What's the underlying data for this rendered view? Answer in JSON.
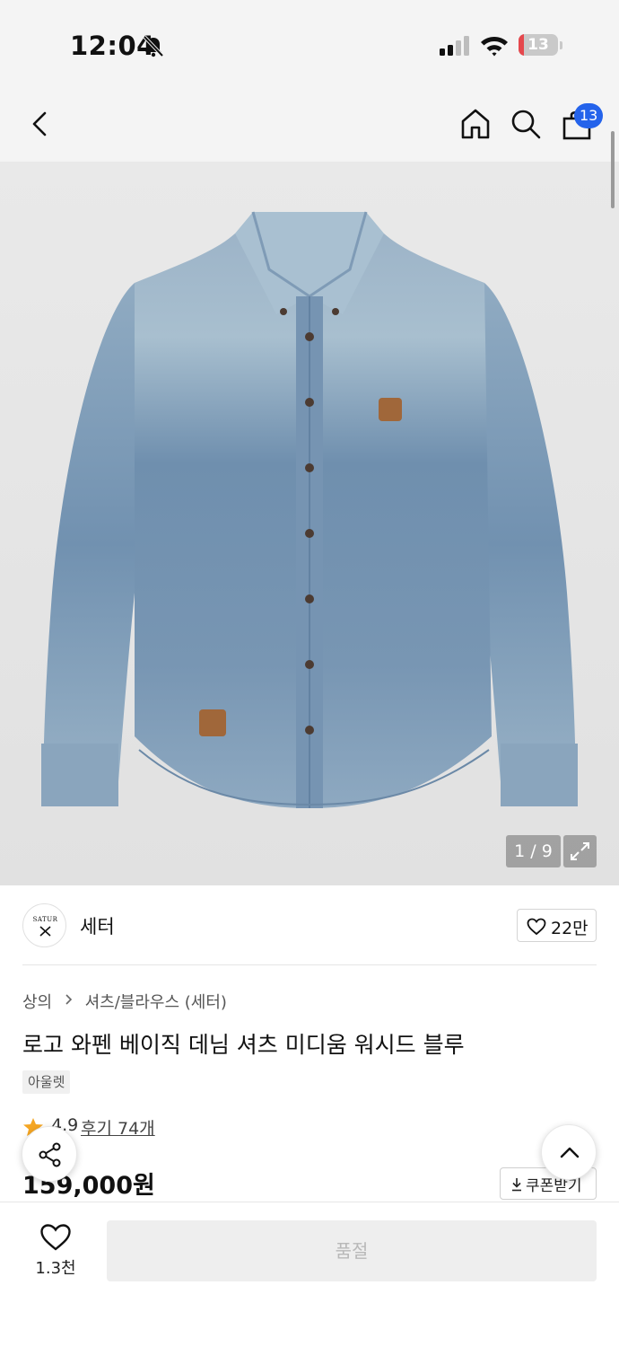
{
  "status_bar": {
    "time": "12:04",
    "battery_level": "13",
    "battery_percent": 13,
    "icons": [
      "bell-slash-icon",
      "cellular-signal-icon",
      "wifi-icon",
      "battery-charging-icon"
    ]
  },
  "nav": {
    "back_icon": "chevron-left-icon",
    "home_icon": "home-icon",
    "search_icon": "search-icon",
    "cart_icon": "shopping-bag-icon",
    "cart_count": "13",
    "badge_color": "#2463eb"
  },
  "gallery": {
    "counter": "1 / 9",
    "expand_icon": "expand-arrows-icon",
    "image_subject": "denim-shirt"
  },
  "brand": {
    "name": "세터",
    "logo_text": "SATUR",
    "like_count": "22만"
  },
  "product": {
    "breadcrumb": [
      "상의",
      "셔츠/블라우스 (세터)"
    ],
    "title": "로고 와펜 베이직 데님 셔츠 미디움 워시드 블루",
    "tag": "아울렛",
    "rating": "4.9",
    "review_link": "후기 74개",
    "price": "159,000원",
    "coupon_label": "쿠폰받기",
    "star_color": "#f5a623"
  },
  "floating": {
    "share_icon": "share-icon",
    "top_icon": "chevron-up-icon"
  },
  "bottom_bar": {
    "wish_count": "1.3천",
    "buy_label": "품절"
  }
}
